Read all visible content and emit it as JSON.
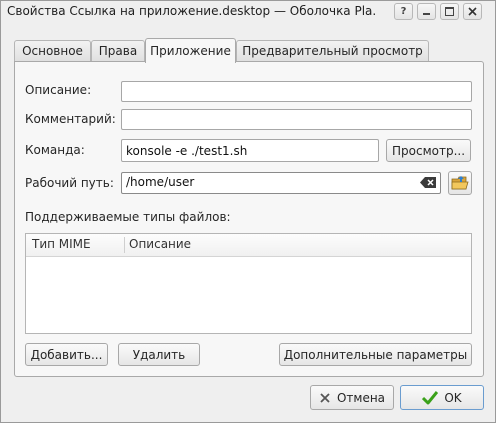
{
  "window": {
    "title": "Свойства Ссылка на приложение.desktop — Оболочка Pla...",
    "buttons": [
      "help",
      "minimize",
      "maximize",
      "close"
    ]
  },
  "tabs": [
    {
      "label": "Основное",
      "active": false
    },
    {
      "label": "Права",
      "active": false
    },
    {
      "label": "Приложение",
      "active": true
    },
    {
      "label": "Предварительный просмотр",
      "active": false
    }
  ],
  "form": {
    "description_label": "Описание:",
    "description_value": "",
    "comment_label": "Комментарий:",
    "comment_value": "",
    "command_label": "Команда:",
    "command_value": "konsole -e ./test1.sh",
    "browse_button": "Просмотр...",
    "workdir_label": "Рабочий путь:",
    "workdir_value": "/home/user",
    "clear_icon": "clear-text-icon",
    "folder_icon": "open-folder-icon"
  },
  "mime": {
    "section_label": "Поддерживаемые типы файлов:",
    "columns": [
      "Тип MIME",
      "Описание"
    ],
    "rows": []
  },
  "buttons": {
    "add": "Добавить...",
    "remove": "Удалить",
    "advanced": "Дополнительные параметры",
    "cancel": "Отмена",
    "ok": "OK"
  },
  "colors": {
    "ok_check": "#3aa11a",
    "cancel_x": "#555555",
    "ok_border": "#6a9ccf"
  }
}
